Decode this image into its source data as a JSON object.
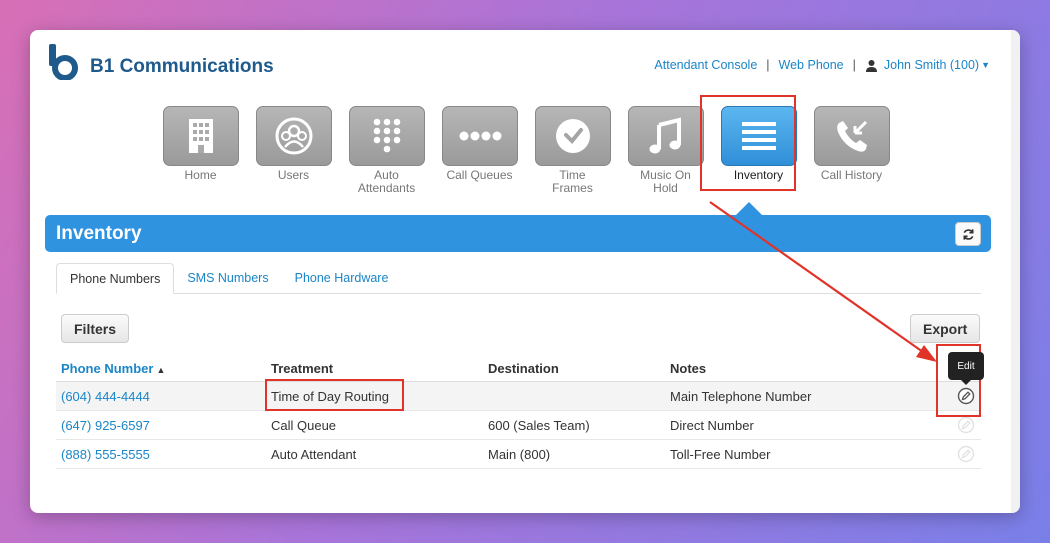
{
  "brand": {
    "name": "B1 Communications"
  },
  "top_links": {
    "attendant_console": "Attendant Console",
    "separator": "|",
    "web_phone": "Web Phone",
    "user": "John Smith (100)"
  },
  "toolbar": {
    "items": [
      {
        "label": "Home",
        "icon": "building-icon"
      },
      {
        "label": "Users",
        "icon": "users-icon"
      },
      {
        "label": "Auto\nAttendants",
        "icon": "keypad-icon"
      },
      {
        "label": "Call Queues",
        "icon": "dots-icon"
      },
      {
        "label": "Time\nFrames",
        "icon": "clock-icon"
      },
      {
        "label": "Music On\nHold",
        "icon": "music-note-icon"
      },
      {
        "label": "Inventory",
        "icon": "list-icon"
      },
      {
        "label": "Call History",
        "icon": "phone-icon"
      }
    ],
    "active": "Inventory"
  },
  "section": {
    "title": "Inventory"
  },
  "tabs": [
    {
      "label": "Phone Numbers"
    },
    {
      "label": "SMS Numbers"
    },
    {
      "label": "Phone Hardware"
    }
  ],
  "buttons": {
    "filters": "Filters",
    "export": "Export"
  },
  "table": {
    "headers": {
      "phone_number": "Phone Number",
      "treatment": "Treatment",
      "destination": "Destination",
      "notes": "Notes"
    },
    "rows": [
      {
        "phone": "(604) 444-4444",
        "treatment": "Time of Day Routing",
        "destination": "",
        "notes": "Main Telephone Number"
      },
      {
        "phone": "(647) 925-6597",
        "treatment": "Call Queue",
        "destination": "600 (Sales Team)",
        "notes": "Direct Number"
      },
      {
        "phone": "(888) 555-5555",
        "treatment": "Auto Attendant",
        "destination": "Main (800)",
        "notes": "Toll-Free Number"
      }
    ]
  },
  "tooltip": {
    "text": "Edit"
  },
  "colors": {
    "accent": "#2f93e0",
    "link": "#1a86c8",
    "brand": "#1f5a8c",
    "annotation": "#e0332a"
  }
}
